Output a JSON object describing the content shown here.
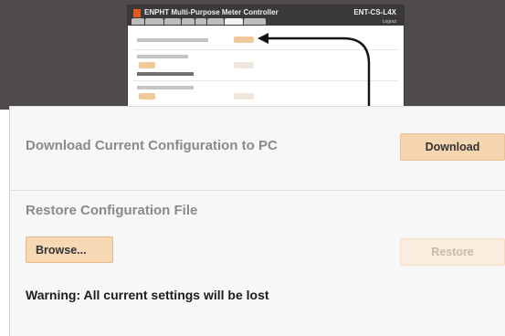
{
  "thumbnail": {
    "title": "ENPHT Multi-Purpose Meter Controller",
    "model": "ENT-CS-L4X",
    "tabs_count": 8,
    "logout_label": "Logout"
  },
  "download": {
    "label": "Download Current Configuration to PC",
    "button_label": "Download"
  },
  "restore": {
    "label": "Restore Configuration File",
    "browse_label": "Browse...",
    "restore_label": "Restore",
    "warning": "Warning: All current settings will be lost"
  },
  "colors": {
    "backdrop": "#4e4b4a",
    "button_orange": "#f6d6b0",
    "button_disabled": "#fbece0",
    "accent": "#e35a1c"
  }
}
